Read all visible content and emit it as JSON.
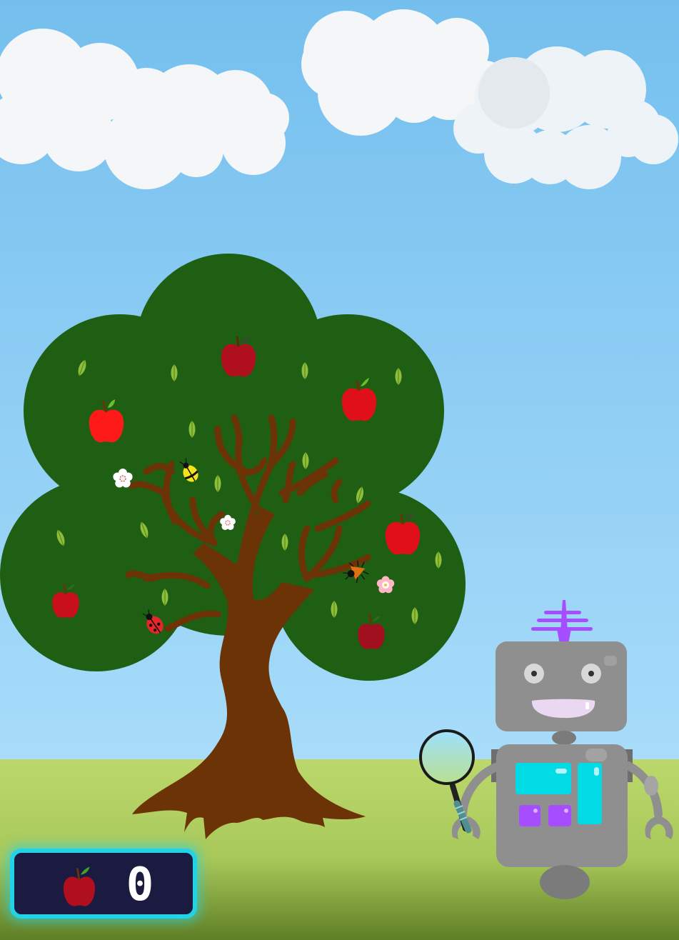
{
  "game": {
    "title": "",
    "apple_counter": {
      "icon": "apple-icon",
      "value": "0"
    }
  },
  "colors": {
    "sky_top": "#74bfee",
    "sky_bottom": "#a8dcfa",
    "grass": "#b9d669",
    "grass_dark": "#6f8d2e",
    "foliage": "#1f5f14",
    "trunk": "#6b3306",
    "apple_red": "#ff1a1a",
    "apple_dark": "#b0101e",
    "robot_body": "#8f8f8f",
    "robot_screen": "#00dbe6",
    "robot_button": "#a64dff",
    "antenna": "#a64dff",
    "counter_bg": "#1b1a40",
    "counter_border": "#22d3e6"
  },
  "scene": {
    "apples": [
      {
        "id": "apple-1",
        "tone": "bright"
      },
      {
        "id": "apple-2",
        "tone": "dark"
      },
      {
        "id": "apple-3",
        "tone": "bright"
      },
      {
        "id": "apple-4",
        "tone": "bright"
      },
      {
        "id": "apple-5",
        "tone": "dark"
      },
      {
        "id": "apple-6",
        "tone": "dark"
      }
    ],
    "bugs": [
      "yellow-beetle-icon",
      "ladybug-icon",
      "orange-beetle-icon"
    ],
    "flowers": [
      "white-flower-icon",
      "white-flower-icon",
      "pink-flower-icon"
    ],
    "robot": {
      "parts": [
        "antenna-icon",
        "robot-head",
        "robot-body",
        "magnifying-glass-icon"
      ]
    }
  }
}
